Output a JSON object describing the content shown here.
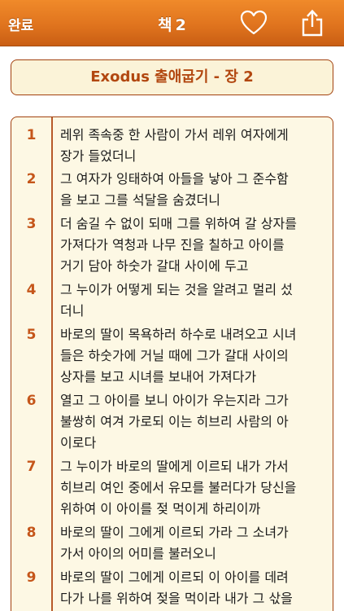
{
  "toolbar": {
    "done_label": "완료",
    "book_label": "책",
    "book_number": "2",
    "favorite_icon": "heart-icon",
    "share_icon": "share-icon"
  },
  "chapter": {
    "title": "Exodus 출애굽기 - 장 2"
  },
  "colors": {
    "toolbar": "#e0741e",
    "accent": "#c5561a",
    "panel_bg": "#fdf8e4",
    "border": "#a2410f"
  },
  "verses": [
    {
      "num": "1",
      "text": "레위 족속중 한 사람이 가서 레위 여자에게\n장가 들었더니"
    },
    {
      "num": "2",
      "text": "그 여자가 잉태하여 아들을 낳아 그 준수함\n을 보고 그를 석달을 숨겼더니"
    },
    {
      "num": "3",
      "text": "더 숨길 수 없이 되매 그를 위하여 갈 상자를\n가져다가 역청과 나무 진을 칠하고 아이를\n거기 담아 하숫가 갈대 사이에 두고"
    },
    {
      "num": "4",
      "text": "그 누이가 어떻게 되는 것을 알려고 멀리 섰\n더니"
    },
    {
      "num": "5",
      "text": "바로의 딸이 목욕하러 하수로 내려오고 시녀\n들은 하숫가에 거닐 때에 그가 갈대 사이의\n상자를 보고 시녀를 보내어 가져다가"
    },
    {
      "num": "6",
      "text": "열고 그 아이를 보니 아이가 우는지라 그가\n불쌍히 여겨 가로되 이는 히브리 사람의 아\n이로다"
    },
    {
      "num": "7",
      "text": "그 누이가 바로의 딸에게 이르되 내가 가서\n히브리 여인 중에서 유모를 불러다가 당신을\n위하여 이 아이를 젖 먹이게 하리이까"
    },
    {
      "num": "8",
      "text": "바로의 딸이 그에게 이르되 가라 그 소녀가\n가서 아이의 어미를 불러오니"
    },
    {
      "num": "9",
      "text": "바로의 딸이 그에게 이르되 이 아이를 데려\n다가 나를 위하여 젖을 먹이라 내가 그 삯을\n주리라 여인이 아이를 데려다가 젖을 먹이더니"
    }
  ]
}
